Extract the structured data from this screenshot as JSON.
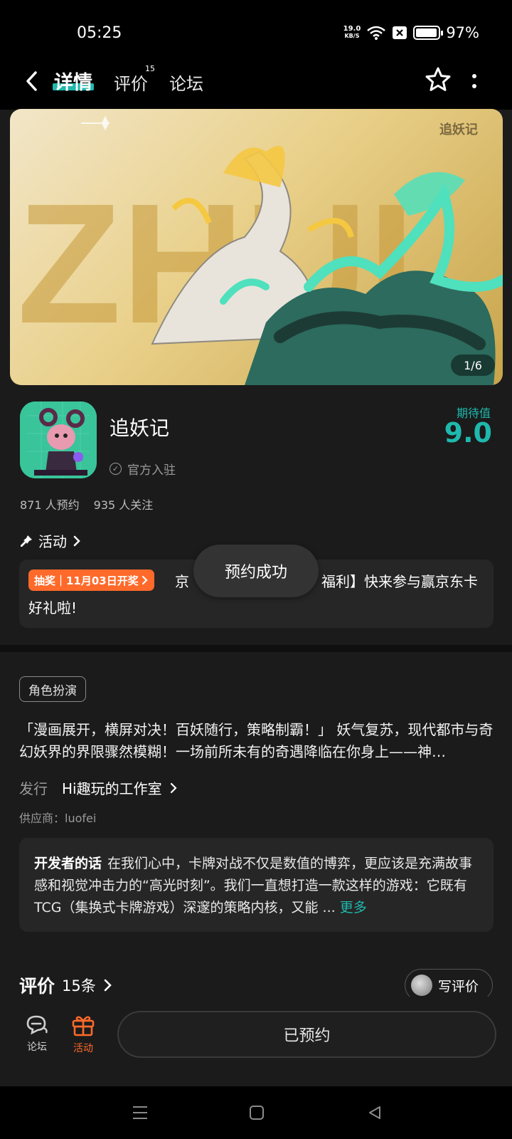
{
  "status_bar": {
    "time": "05:25",
    "net_speed_value": "19.0",
    "net_speed_unit": "KB/S",
    "battery_pct": "97%",
    "battery_level": 0.97
  },
  "header": {
    "tabs": [
      {
        "label": "详情",
        "active": true
      },
      {
        "label": "评价",
        "count": "15"
      },
      {
        "label": "论坛"
      }
    ],
    "icons": [
      "back-icon",
      "star-icon",
      "more-vertical-icon"
    ]
  },
  "banner": {
    "watermark": "追妖记",
    "page_indicator": "1/6"
  },
  "game": {
    "title": "追妖记",
    "official_label": "官方入驻",
    "expect_label": "期待值",
    "expect_score": "9.0",
    "reservations": "871 人预约",
    "followers": "935 人关注"
  },
  "activity": {
    "header": "活动",
    "tag": "抽奖｜11月03日开奖",
    "text_line1": "京东卡福利】快来参与赢京东卡",
    "text_line1_visible_start": "京",
    "text_line1_visible_end": "福利】快来参与赢京东卡",
    "text_line2": "好礼啦!"
  },
  "toast": "预约成功",
  "details": {
    "genre_tag": "角色扮演",
    "description": "「漫画展开，横屏对决！百妖随行，策略制霸！」 妖气复苏，现代都市与奇幻妖界的界限骤然模糊！一场前所未有的奇遇降临在你身上——神…",
    "publisher_label": "发行",
    "publisher_name": "Hi趣玩的工作室",
    "supplier": "供应商：luofei"
  },
  "dev_note": {
    "label": "开发者的话",
    "text": "在我们心中，卡牌对战不仅是数值的博弈，更应该是充满故事感和视觉冲击力的“高光时刻”。我们一直想打造一款这样的游戏：它既有TCG（集换式卡牌游戏）深邃的策略内核，又能 ...",
    "more": "更多"
  },
  "reviews": {
    "title": "评价",
    "count": "15条",
    "write_label": "写评价"
  },
  "bottom_bar": {
    "forum_label": "论坛",
    "activity_label": "活动",
    "reserved_label": "已预约",
    "colors": {
      "forum": "#cfcfcf",
      "activity": "#ff6a2a"
    }
  },
  "accent_color": "#1fb8ad"
}
